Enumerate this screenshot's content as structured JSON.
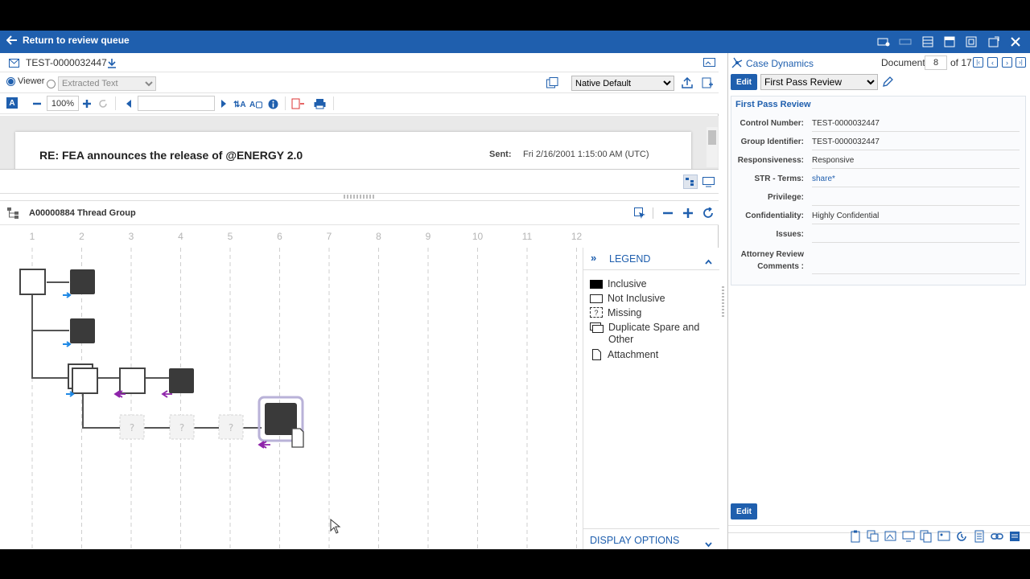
{
  "header": {
    "back_label": "Return to review queue"
  },
  "document": {
    "id": "TEST-0000032447",
    "viewer_label": "Viewer",
    "extracted_text_placeholder": "Extracted Text",
    "native_default": "Native Default",
    "zoom": "100%",
    "subject": "RE: FEA announces the release of @ENERGY 2.0",
    "sent_label": "Sent:",
    "sent_value": "Fri 2/16/2001 1:15:00 AM (UTC)"
  },
  "thread": {
    "title": "A00000884 Thread Group",
    "columns": [
      "1",
      "2",
      "3",
      "4",
      "5",
      "6",
      "7",
      "8",
      "9",
      "10",
      "11",
      "12"
    ],
    "missing_mark": "?"
  },
  "legend": {
    "title": "LEGEND",
    "expand_glyph": "»",
    "items": [
      {
        "label": "Inclusive"
      },
      {
        "label": "Not Inclusive"
      },
      {
        "label": "Missing",
        "mark": "?"
      },
      {
        "label": "Duplicate Spare and Other"
      },
      {
        "label": "Attachment"
      }
    ],
    "display_options": "DISPLAY OPTIONS"
  },
  "panel": {
    "title": "Case Dynamics",
    "document_label": "Document",
    "current": "8",
    "of_total": "of 17",
    "edit_label": "Edit",
    "layout": "First Pass Review",
    "section_title": "First Pass Review",
    "fields": [
      {
        "label": "Control Number:",
        "value": "TEST-0000032447"
      },
      {
        "label": "Group Identifier:",
        "value": "TEST-0000032447"
      },
      {
        "label": "Responsiveness:",
        "value": "Responsive"
      },
      {
        "label": "STR - Terms:",
        "value": "share*"
      },
      {
        "label": "Privilege:",
        "value": ""
      },
      {
        "label": "Confidentiality:",
        "value": "Highly Confidential"
      },
      {
        "label": "Issues:",
        "value": ""
      },
      {
        "label": "Attorney Review Comments :",
        "value": ""
      }
    ],
    "bottom_edit_label": "Edit"
  },
  "colors": {
    "brand": "#1f5fae",
    "inclusive": "#3a3a3a",
    "arrow_blue": "#1e88e5",
    "arrow_purple": "#8e24aa"
  }
}
